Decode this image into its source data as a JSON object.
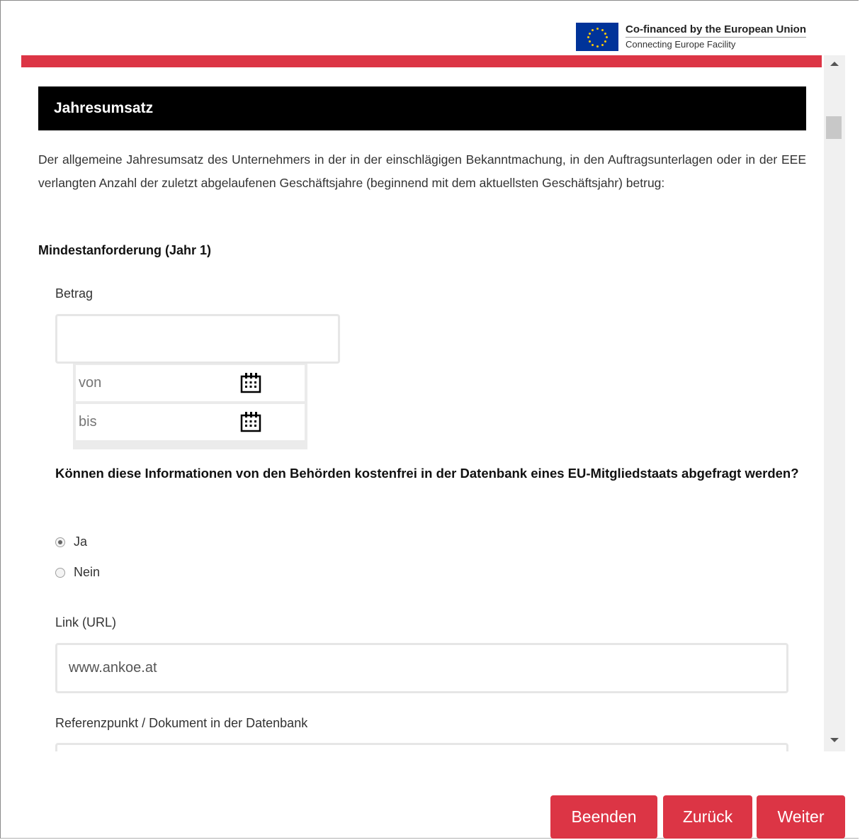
{
  "header": {
    "eu_title": "Co-financed by the European Union",
    "eu_subtitle": "Connecting Europe Facility"
  },
  "section": {
    "title": "Jahresumsatz",
    "description": "Der allgemeine Jahresumsatz des Unternehmers in der in der einschlägigen Bekanntmachung, in den Auftragsunterlagen oder in der EEE verlangten Anzahl der zuletzt abgelaufenen Geschäftsjahre (beginnend mit dem aktuellsten Geschäftsjahr) betrug:"
  },
  "requirement": {
    "title": "Mindestanforderung (Jahr 1)",
    "amount_label": "Betrag",
    "amount_value": "",
    "from_placeholder": "von",
    "to_placeholder": "bis"
  },
  "question": {
    "text": "Können diese Informationen von den Behörden kostenfrei in der Datenbank eines EU-Mitgliedstaats abgefragt werden?",
    "options": [
      {
        "label": "Ja",
        "checked": true
      },
      {
        "label": "Nein",
        "checked": false
      }
    ]
  },
  "link": {
    "label": "Link (URL)",
    "value": "www.ankoe.at"
  },
  "reference": {
    "label": "Referenzpunkt / Dokument in der Datenbank",
    "value": ""
  },
  "footer": {
    "finish_label": "Beenden",
    "back_label": "Zurück",
    "next_label": "Weiter"
  },
  "colors": {
    "accent": "#dc3545",
    "heading_bg": "#000000",
    "eu_blue": "#003399",
    "eu_star": "#ffcc00"
  }
}
